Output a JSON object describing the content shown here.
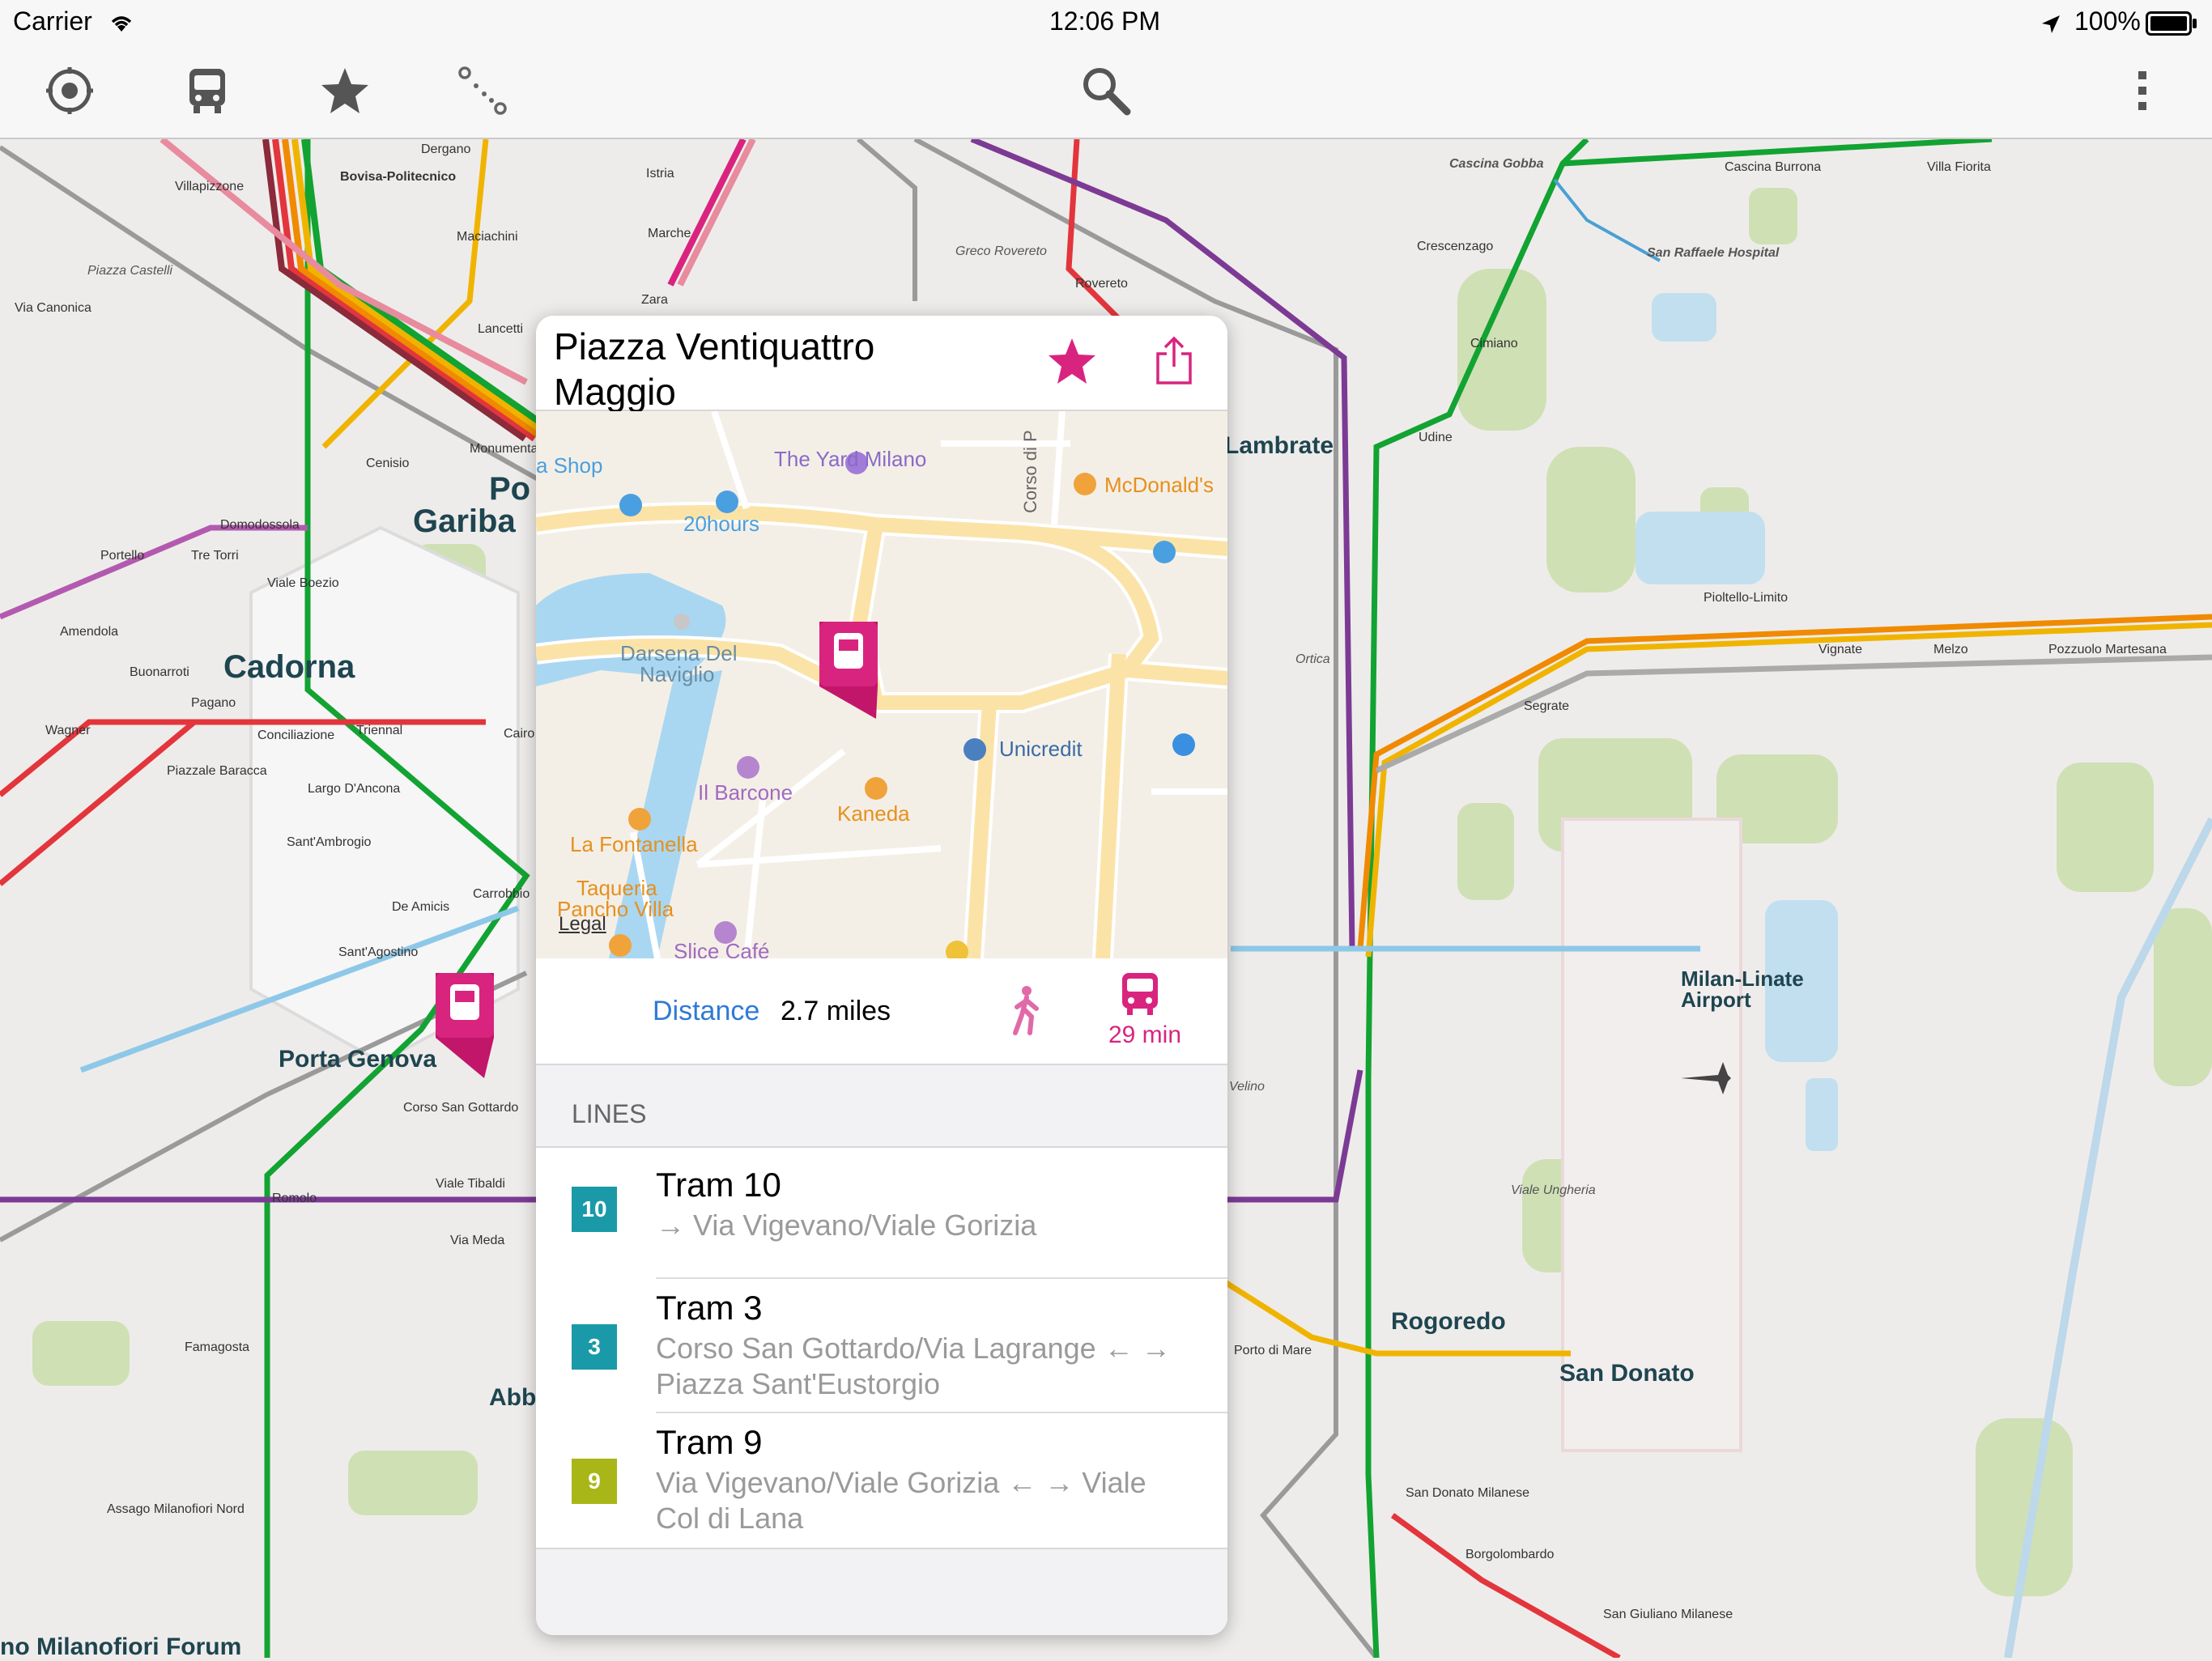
{
  "status_bar": {
    "carrier": "Carrier",
    "time": "12:06 PM",
    "battery": "100%"
  },
  "toolbar": {
    "icons": [
      "locate-icon",
      "bus-icon",
      "star-icon",
      "route-icon",
      "search-icon",
      "more-icon"
    ]
  },
  "map": {
    "large_labels": [
      "Cadorna",
      "Porta Genova",
      "Po",
      "Gariba",
      "Lambrate",
      "Rogoredo",
      "San Donato",
      "Abb",
      "no Milanofiori Forum"
    ],
    "medium_labels": [
      "Milan-Linate",
      "Airport"
    ],
    "small_labels": [
      "Dergano",
      "Bovisa-Politecnico",
      "Villapizzone",
      "Istria",
      "Marche",
      "Maciachini",
      "Zara",
      "Lancetti",
      "Monumentale",
      "Cenisio",
      "Domodossola",
      "Portello",
      "Tre Torri",
      "Amendola",
      "Buonarroti",
      "Pagano",
      "Wagner",
      "Conciliazione",
      "Triennal",
      "Cairo",
      "Sant'Ambrogio",
      "De Amicis",
      "Sant'Agostino",
      "Romolo",
      "Famagosta",
      "Assago Milanofiori Nord",
      "Cascina Gobba",
      "Cascina Burrona",
      "Villa Fiorita",
      "San Raffaele Hospital",
      "Crescenzago",
      "Cimiano",
      "Udine",
      "Pioltello-Limito",
      "Vignate",
      "Melzo",
      "Pozzuolo Martesana",
      "Segrate",
      "Porto di Mare",
      "San Donato Milanese",
      "Borgolombardo",
      "San Giuliano Milanese",
      "Greco Rovereto",
      "Rovereto",
      "Piazza Castelli",
      "Via Canonica",
      "Viale Ungheria",
      "Ortica",
      "Velino",
      "Largo D'Ancona",
      "Piazzale Baracca",
      "Viale Boezio",
      "Corso San Gottardo",
      "Via Meda",
      "Carrobbio",
      "Viale Tibaldi"
    ]
  },
  "station_card": {
    "title": "Piazza Ventiquattro Maggio",
    "mini_map": {
      "labels": [
        "a Shop",
        "20hours",
        "The Yard Milano",
        "McDonald's",
        "Darsena Del",
        "Naviglio",
        "Unicredit",
        "Il Barcone",
        "Kaneda",
        "La Fontanella",
        "Taqueria",
        "Pancho Villa",
        "Slice Café",
        "Corso di P",
        "Legal"
      ]
    },
    "distance_label": "Distance",
    "distance_value": "2.7 miles",
    "transit_time": "29 min",
    "lines_header": "LINES",
    "lines": [
      {
        "badge": "10",
        "color": "#1a9aa8",
        "name": "Tram 10",
        "destination": "→ Via Vigevano/Viale Gorizia"
      },
      {
        "badge": "3",
        "color": "#1a9aa8",
        "name": "Tram 3",
        "destination": "Corso San Gottardo/Via Lagrange ← → Piazza Sant'Eustorgio"
      },
      {
        "badge": "9",
        "color": "#a9b617",
        "name": "Tram 9",
        "destination": "Via Vigevano/Viale Gorizia ← → Viale Col di Lana"
      }
    ]
  },
  "colors": {
    "accent_pink": "#d9247f",
    "link_blue": "#2f7ad6",
    "line_green": "#12a332",
    "line_red": "#e3353c",
    "line_purple": "#7c3a95",
    "line_yellow": "#f0b400",
    "line_blue": "#8ec8e8"
  }
}
